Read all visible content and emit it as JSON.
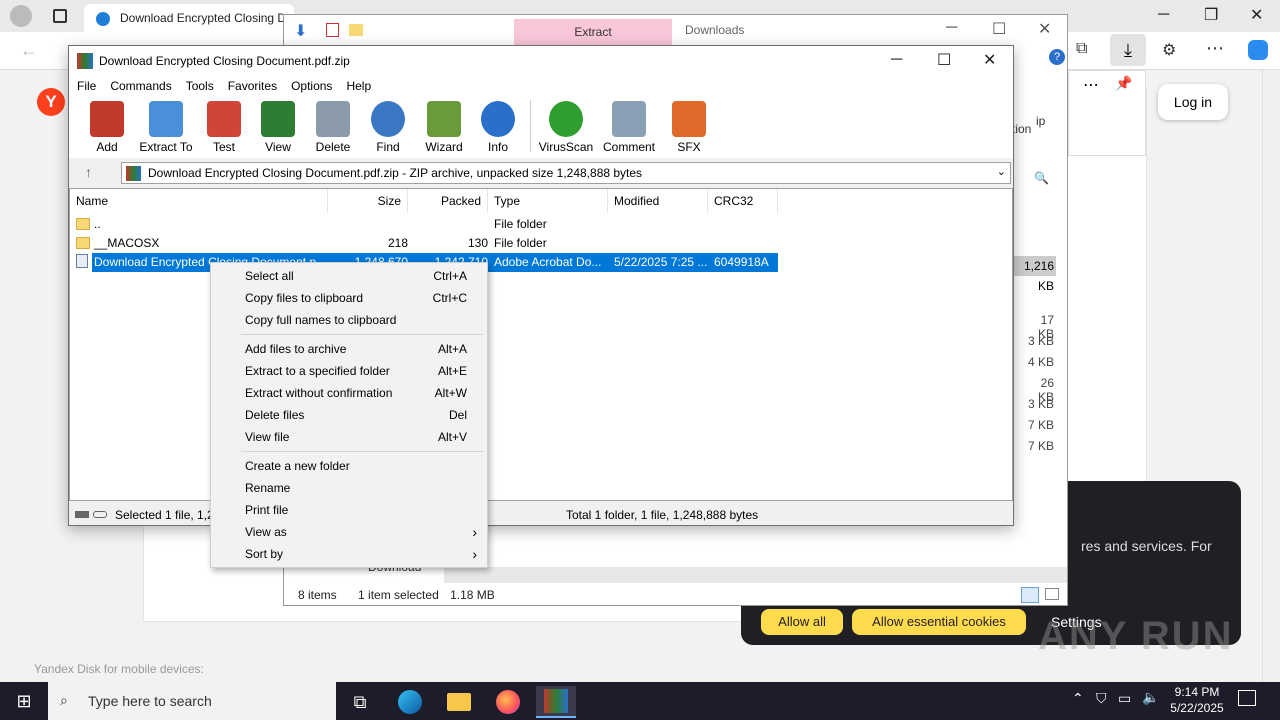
{
  "browser": {
    "tab_title": "Download Encrypted Closing D",
    "login": "Log in",
    "footer": "Yandex Disk for mobile devices:",
    "logo": "Y",
    "cookie_text": "res and services. For",
    "cookie_allow_all": "Allow all",
    "cookie_allow_essential": "Allow essential cookies",
    "cookie_settings": "Settings",
    "peek_1": "tion",
    "peek_2": "ip"
  },
  "explorer": {
    "tab_extract": "Extract",
    "tab_downloads": "Downloads",
    "selected_size": "1,216 KB",
    "file_sizes": [
      "17 KB",
      "3 KB",
      "4 KB",
      "26 KB",
      "3 KB",
      "7 KB",
      "7 KB"
    ],
    "status_items": "8 items",
    "status_selected": "1 item selected",
    "status_size": "1.18 MB",
    "partial_name": "Download"
  },
  "winrar": {
    "title": "Download Encrypted Closing Document.pdf.zip",
    "menu": [
      "File",
      "Commands",
      "Tools",
      "Favorites",
      "Options",
      "Help"
    ],
    "toolbar": [
      {
        "label": "Add",
        "icon": "add-archive-icon",
        "color": "#c0392b"
      },
      {
        "label": "Extract To",
        "icon": "extract-folder-icon",
        "color": "#4a90d9"
      },
      {
        "label": "Test",
        "icon": "test-clipboard-icon",
        "color": "#c0392b"
      },
      {
        "label": "View",
        "icon": "view-book-icon",
        "color": "#2e7d32"
      },
      {
        "label": "Delete",
        "icon": "trash-icon",
        "color": "#8a9aa8"
      },
      {
        "label": "Find",
        "icon": "magnifier-icon",
        "color": "#3a78c4"
      },
      {
        "label": "Wizard",
        "icon": "magic-wand-icon",
        "color": "#6a9a3a"
      },
      {
        "label": "Info",
        "icon": "info-icon",
        "color": "#2a6fc9"
      },
      {
        "label": "VirusScan",
        "icon": "virus-scan-icon",
        "color": "#2e9e2e"
      },
      {
        "label": "Comment",
        "icon": "comment-icon",
        "color": "#8aa0b4"
      },
      {
        "label": "SFX",
        "icon": "sfx-box-icon",
        "color": "#e06a2a"
      }
    ],
    "path": "Download Encrypted Closing Document.pdf.zip - ZIP archive, unpacked size 1,248,888 bytes",
    "columns": [
      "Name",
      "Size",
      "Packed",
      "Type",
      "Modified",
      "CRC32"
    ],
    "rows": [
      {
        "name": "..",
        "size": "",
        "packed": "",
        "type": "File folder",
        "modified": "",
        "crc": ""
      },
      {
        "name": "__MACOSX",
        "size": "218",
        "packed": "130",
        "type": "File folder",
        "modified": "",
        "crc": ""
      },
      {
        "name": "Download Encrypted Closing Document.p",
        "size": "1,248,670",
        "packed": "1,242,710",
        "type": "Adobe Acrobat Do...",
        "modified": "5/22/2025 7:25 ...",
        "crc": "6049918A"
      }
    ],
    "status_left": "Selected 1 file, 1,24",
    "status_right": "Total 1 folder, 1 file, 1,248,888 bytes"
  },
  "context_menu": [
    {
      "label": "Select all",
      "shortcut": "Ctrl+A"
    },
    {
      "label": "Copy files to clipboard",
      "shortcut": "Ctrl+C"
    },
    {
      "label": "Copy full names to clipboard",
      "shortcut": ""
    },
    {
      "label": "Add files to archive",
      "shortcut": "Alt+A"
    },
    {
      "label": "Extract to a specified folder",
      "shortcut": "Alt+E"
    },
    {
      "label": "Extract without confirmation",
      "shortcut": "Alt+W"
    },
    {
      "label": "Delete files",
      "shortcut": "Del"
    },
    {
      "label": "View file",
      "shortcut": "Alt+V"
    },
    {
      "label": "Create a new folder",
      "shortcut": ""
    },
    {
      "label": "Rename",
      "shortcut": ""
    },
    {
      "label": "Print file",
      "shortcut": ""
    },
    {
      "label": "View as",
      "shortcut": "›"
    },
    {
      "label": "Sort by",
      "shortcut": "›"
    }
  ],
  "taskbar": {
    "search_placeholder": "Type here to search",
    "time": "9:14 PM",
    "date": "5/22/2025"
  },
  "watermark": "ANY RUN"
}
